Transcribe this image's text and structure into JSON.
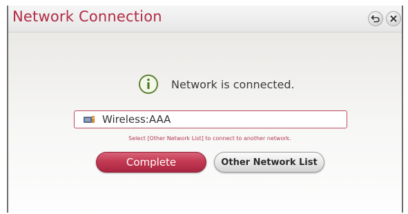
{
  "dialog": {
    "title": "Network Connection",
    "back_icon": "back-icon",
    "close_icon": "close-icon"
  },
  "status": {
    "icon": "info-icon",
    "message": "Network is connected."
  },
  "network": {
    "icon": "wireless-icon",
    "label": "Wireless:AAA"
  },
  "hint": "Select [Other Network List] to connect to another network.",
  "buttons": {
    "complete": "Complete",
    "other_network_list": "Other Network List"
  },
  "colors": {
    "accent": "#b12b45",
    "primary_button": "#c43a53"
  }
}
